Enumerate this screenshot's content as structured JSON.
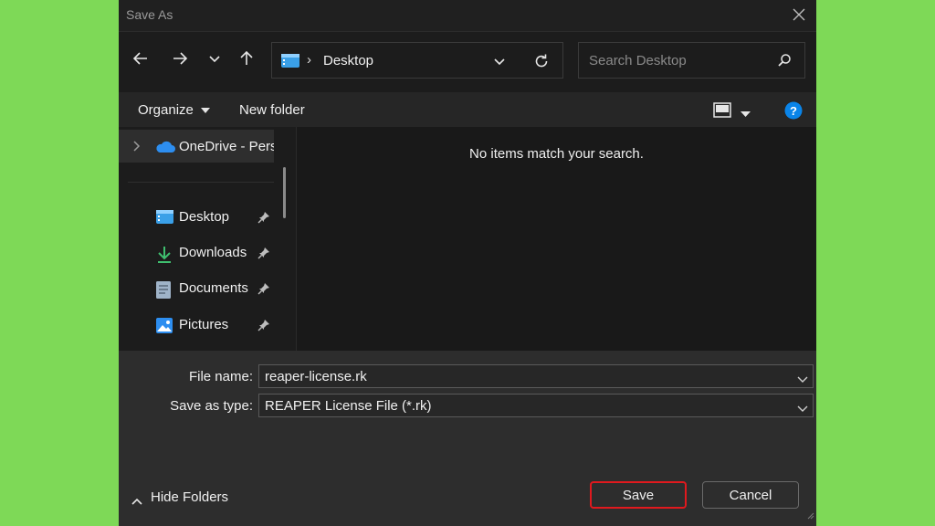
{
  "window": {
    "title": "Save As"
  },
  "nav": {
    "back_icon": "arrow-left-icon",
    "forward_icon": "arrow-right-icon",
    "recent_icon": "chevron-down-icon",
    "up_icon": "arrow-up-icon"
  },
  "address": {
    "separator": "›",
    "location": "Desktop"
  },
  "search": {
    "placeholder": "Search Desktop"
  },
  "toolbar": {
    "organize_label": "Organize",
    "new_folder_label": "New folder"
  },
  "sidebar": {
    "onedrive_label": "OneDrive - Personal",
    "quick_access": [
      {
        "label": "Desktop",
        "icon": "desktop-folder-icon"
      },
      {
        "label": "Downloads",
        "icon": "download-icon"
      },
      {
        "label": "Documents",
        "icon": "document-icon"
      },
      {
        "label": "Pictures",
        "icon": "pictures-icon"
      }
    ]
  },
  "main": {
    "empty_message": "No items match your search."
  },
  "form": {
    "file_name_label": "File name:",
    "file_name_value": "reaper-license.rk",
    "save_type_label": "Save as type:",
    "save_type_value": "REAPER License File (*.rk)"
  },
  "footer": {
    "hide_folders_label": "Hide Folders",
    "save_label": "Save",
    "cancel_label": "Cancel"
  },
  "colors": {
    "background": "#7ed957",
    "dialog": "#202020",
    "save_highlight": "#e0191e",
    "accent": "#0a84e8"
  }
}
